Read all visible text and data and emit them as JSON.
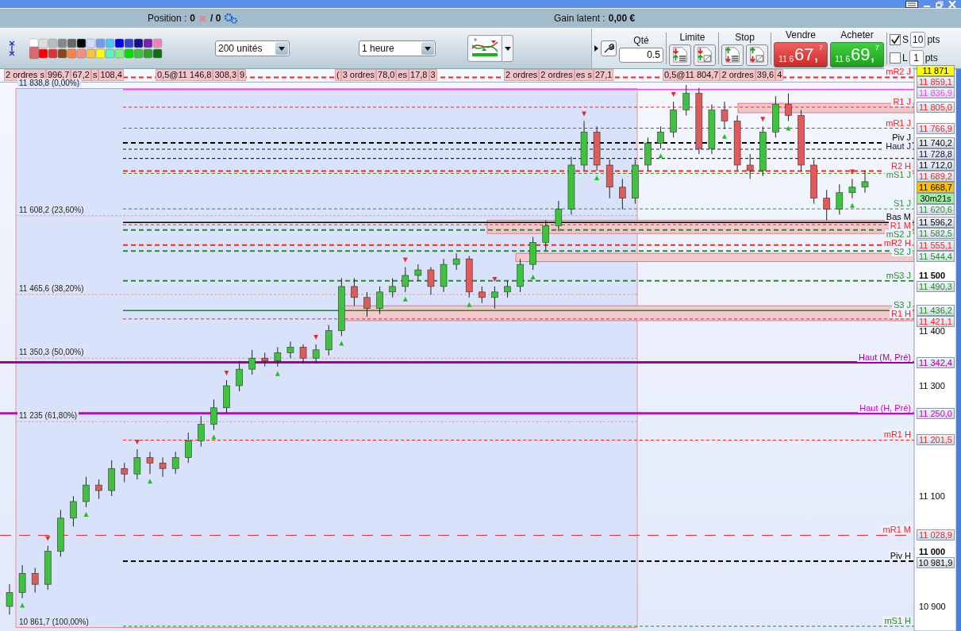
{
  "position_bar": {
    "position_label": "Position :",
    "position_value": "0",
    "orders_value": "/ 0",
    "gain_label": "Gain latent :",
    "gain_value": "0,00 €"
  },
  "toolbar": {
    "units": "200 unités",
    "period": "1 heure"
  },
  "order_panel": {
    "qty_label": "Qté",
    "qty": "0.5",
    "limit_label": "Limite",
    "stop_label": "Stop",
    "sell": {
      "label": "Vendre",
      "prefix": "11 6",
      "main": "67,",
      "sup": "7"
    },
    "buy": {
      "label": "Acheter",
      "prefix": "11 6",
      "main": "69,",
      "sup": "7"
    },
    "options": [
      {
        "label": "S",
        "checked": true,
        "value": "10",
        "unit": "pts"
      },
      {
        "label": "L",
        "checked": false,
        "value": "1",
        "unit": "pts"
      }
    ]
  },
  "order_tags": [
    [
      "2 ordres s",
      "996,7",
      "67,2",
      "s",
      "108,4"
    ],
    [
      "0,5@11 146,8",
      "308,3",
      "9"
    ],
    [
      "(",
      "3 ordres",
      "78,0",
      "es",
      "17,8",
      "3"
    ],
    [
      "2 ordres",
      "2 ordres",
      "es s",
      "27,1"
    ],
    [
      "0,5@11 804,7",
      "2 ordres",
      "39,6",
      "4"
    ]
  ],
  "fibonacci": [
    "11 838,8 (0,00%)",
    "11 608,2 (23,60%)",
    "11 465,6 (38,20%)",
    "11 350,3 (50,00%)",
    "11 235 (61,80%)",
    "10 861,7 (100,00%)"
  ],
  "high_tag": "11 871",
  "levels": [
    {
      "label": "mR2 J",
      "tag": "11 859,1",
      "color": "#ff2020",
      "kind": "dash"
    },
    {
      "tag": "11 836,9",
      "color": "#ff40ff",
      "kind": "solid"
    },
    {
      "label": "R1 J",
      "tag": "11 805,0",
      "color": "#ff2020",
      "kind": "dash_thin"
    },
    {
      "label": "mR1 J",
      "tag": "11 766,9",
      "color": "#ff2020",
      "kind": "dash_thin"
    },
    {
      "label": "Piv J",
      "tag": "11 740,2",
      "color": "#000000",
      "kind": "dash"
    },
    {
      "label": "Haut J",
      "tag": "11 728,8",
      "color": "#101040",
      "kind": "dash_thin"
    },
    {
      "tag": "11 712,0",
      "color": "#000000",
      "kind": "dash_thin"
    },
    {
      "label": "R2 H",
      "tag": "11 689,2",
      "color": "#ff2020",
      "kind": "dash"
    },
    {
      "label": "mS1 J",
      "color": "#4a8a2a",
      "kind": "dash_thin"
    },
    {
      "label": "S1 J",
      "tag": "11 620,6",
      "color": "#2a9a2a",
      "kind": "dash_thin"
    },
    {
      "label": "Bas M",
      "tag": "11 596,2",
      "color": "#000000",
      "kind": "solid"
    },
    {
      "label": "R1 M",
      "color": "#ff2020",
      "kind": "dash_thin"
    },
    {
      "label": "mS2 J",
      "tag": "11 582,5",
      "color": "#2a8a2a",
      "kind": "dash"
    },
    {
      "label": "mR2 H",
      "tag": "11 555,1",
      "color": "#ff2020",
      "kind": "dash"
    },
    {
      "label": "S2 J",
      "tag": "11 544,4",
      "color": "#2a8a2a",
      "kind": "dash"
    },
    {
      "label": "mS3 J",
      "tag": "11 490,3",
      "color": "#2a8a2a",
      "kind": "dash"
    },
    {
      "label": "S3 J",
      "tag": "11 436,2",
      "color": "#208a20",
      "kind": "solid"
    },
    {
      "label": "R1 H",
      "tag": "11 421,1",
      "color": "#ff2020",
      "kind": "dash_thin"
    },
    {
      "label": "Haut (M, Pré)",
      "tag": "11 342,4",
      "color": "#a000a0",
      "kind": "thick"
    },
    {
      "label": "Haut (H, Pré)",
      "tag": "11 250,0",
      "color": "#cc00cc",
      "kind": "thick"
    },
    {
      "label": "mR1 H",
      "tag": "11 201,5",
      "color": "#ff2020",
      "kind": "dash_thin"
    },
    {
      "label": "mR1 M",
      "tag": "11 028,9",
      "color": "#ff2020",
      "kind": "longdash"
    },
    {
      "label": "Piv H",
      "tag": "10 981,9",
      "color": "#000000",
      "kind": "dash"
    },
    {
      "label": "mS1 H",
      "color": "#2a8a2a",
      "kind": "dash_thin"
    }
  ],
  "current": {
    "price": "11 668,7",
    "countdown": "30m21s"
  },
  "chart_data": {
    "type": "candlestick",
    "ylim": [
      10855.4,
      11874.1
    ],
    "yticks": [
      {
        "value": 11500,
        "label": "11 500"
      },
      {
        "value": 11400,
        "label": "11 400"
      },
      {
        "value": 11300,
        "label": "11 300"
      },
      {
        "value": 11100,
        "label": "11 100"
      },
      {
        "value": 11000,
        "label": "11 000"
      },
      {
        "value": 10900,
        "label": "10 900"
      }
    ],
    "categories": [
      null,
      null,
      null,
      null,
      null,
      null,
      null,
      null,
      null,
      null,
      null,
      null,
      null,
      null,
      null,
      null,
      null,
      null,
      null,
      null,
      null,
      null,
      null,
      null,
      null,
      null,
      null,
      null,
      null,
      null,
      null,
      null,
      null,
      null,
      null,
      null,
      null,
      null,
      null,
      null,
      null,
      null,
      null,
      null,
      null,
      null,
      null,
      null,
      null,
      null,
      null,
      null,
      null,
      null,
      null,
      null,
      null,
      null,
      null,
      null,
      null,
      null,
      null,
      null,
      null,
      null,
      null,
      null
    ],
    "ohlc": [
      [
        10900,
        10940,
        10885,
        10925
      ],
      [
        10925,
        10975,
        10915,
        10960
      ],
      [
        10960,
        10970,
        10925,
        10940
      ],
      [
        10940,
        11010,
        10930,
        11000
      ],
      [
        11000,
        11075,
        10990,
        11060
      ],
      [
        11060,
        11100,
        11045,
        11090
      ],
      [
        11090,
        11135,
        11080,
        11120
      ],
      [
        11120,
        11130,
        11095,
        11110
      ],
      [
        11110,
        11165,
        11100,
        11150
      ],
      [
        11150,
        11160,
        11125,
        11140
      ],
      [
        11140,
        11185,
        11130,
        11170
      ],
      [
        11170,
        11180,
        11140,
        11160
      ],
      [
        11160,
        11170,
        11135,
        11150
      ],
      [
        11150,
        11180,
        11140,
        11170
      ],
      [
        11170,
        11215,
        11160,
        11200
      ],
      [
        11200,
        11245,
        11190,
        11230
      ],
      [
        11230,
        11275,
        11220,
        11260
      ],
      [
        11260,
        11310,
        11250,
        11300
      ],
      [
        11300,
        11345,
        11290,
        11330
      ],
      [
        11330,
        11365,
        11320,
        11350
      ],
      [
        11350,
        11360,
        11335,
        11345
      ],
      [
        11345,
        11370,
        11335,
        11360
      ],
      [
        11360,
        11380,
        11350,
        11370
      ],
      [
        11370,
        11375,
        11340,
        11350
      ],
      [
        11350,
        11375,
        11340,
        11365
      ],
      [
        11365,
        11410,
        11355,
        11400
      ],
      [
        11400,
        11495,
        11390,
        11480
      ],
      [
        11480,
        11495,
        11445,
        11460
      ],
      [
        11460,
        11470,
        11425,
        11440
      ],
      [
        11440,
        11480,
        11430,
        11470
      ],
      [
        11470,
        11495,
        11460,
        11480
      ],
      [
        11480,
        11515,
        11470,
        11500
      ],
      [
        11500,
        11520,
        11490,
        11510
      ],
      [
        11510,
        11515,
        11465,
        11480
      ],
      [
        11480,
        11530,
        11470,
        11520
      ],
      [
        11520,
        11540,
        11510,
        11530
      ],
      [
        11530,
        11535,
        11460,
        11470
      ],
      [
        11470,
        11480,
        11450,
        11460
      ],
      [
        11460,
        11480,
        11440,
        11470
      ],
      [
        11470,
        11490,
        11460,
        11480
      ],
      [
        11480,
        11530,
        11470,
        11520
      ],
      [
        11520,
        11570,
        11510,
        11560
      ],
      [
        11560,
        11600,
        11545,
        11590
      ],
      [
        11590,
        11635,
        11580,
        11620
      ],
      [
        11620,
        11715,
        11610,
        11700
      ],
      [
        11700,
        11780,
        11690,
        11760
      ],
      [
        11760,
        11770,
        11690,
        11700
      ],
      [
        11700,
        11710,
        11640,
        11660
      ],
      [
        11660,
        11675,
        11620,
        11640
      ],
      [
        11640,
        11710,
        11630,
        11700
      ],
      [
        11700,
        11750,
        11690,
        11740
      ],
      [
        11740,
        11770,
        11730,
        11760
      ],
      [
        11760,
        11815,
        11750,
        11800
      ],
      [
        11800,
        11845,
        11790,
        11830
      ],
      [
        11830,
        11840,
        11720,
        11730
      ],
      [
        11730,
        11810,
        11720,
        11800
      ],
      [
        11800,
        11815,
        11765,
        11780
      ],
      [
        11780,
        11790,
        11690,
        11700
      ],
      [
        11700,
        11720,
        11675,
        11690
      ],
      [
        11690,
        11770,
        11680,
        11760
      ],
      [
        11760,
        11825,
        11750,
        11810
      ],
      [
        11810,
        11830,
        11780,
        11790
      ],
      [
        11790,
        11800,
        11690,
        11700
      ],
      [
        11700,
        11710,
        11630,
        11640
      ],
      [
        11640,
        11655,
        11600,
        11620
      ],
      [
        11620,
        11665,
        11610,
        11650
      ],
      [
        11650,
        11675,
        11640,
        11660
      ],
      [
        11660,
        11690,
        11650,
        11670
      ]
    ]
  }
}
